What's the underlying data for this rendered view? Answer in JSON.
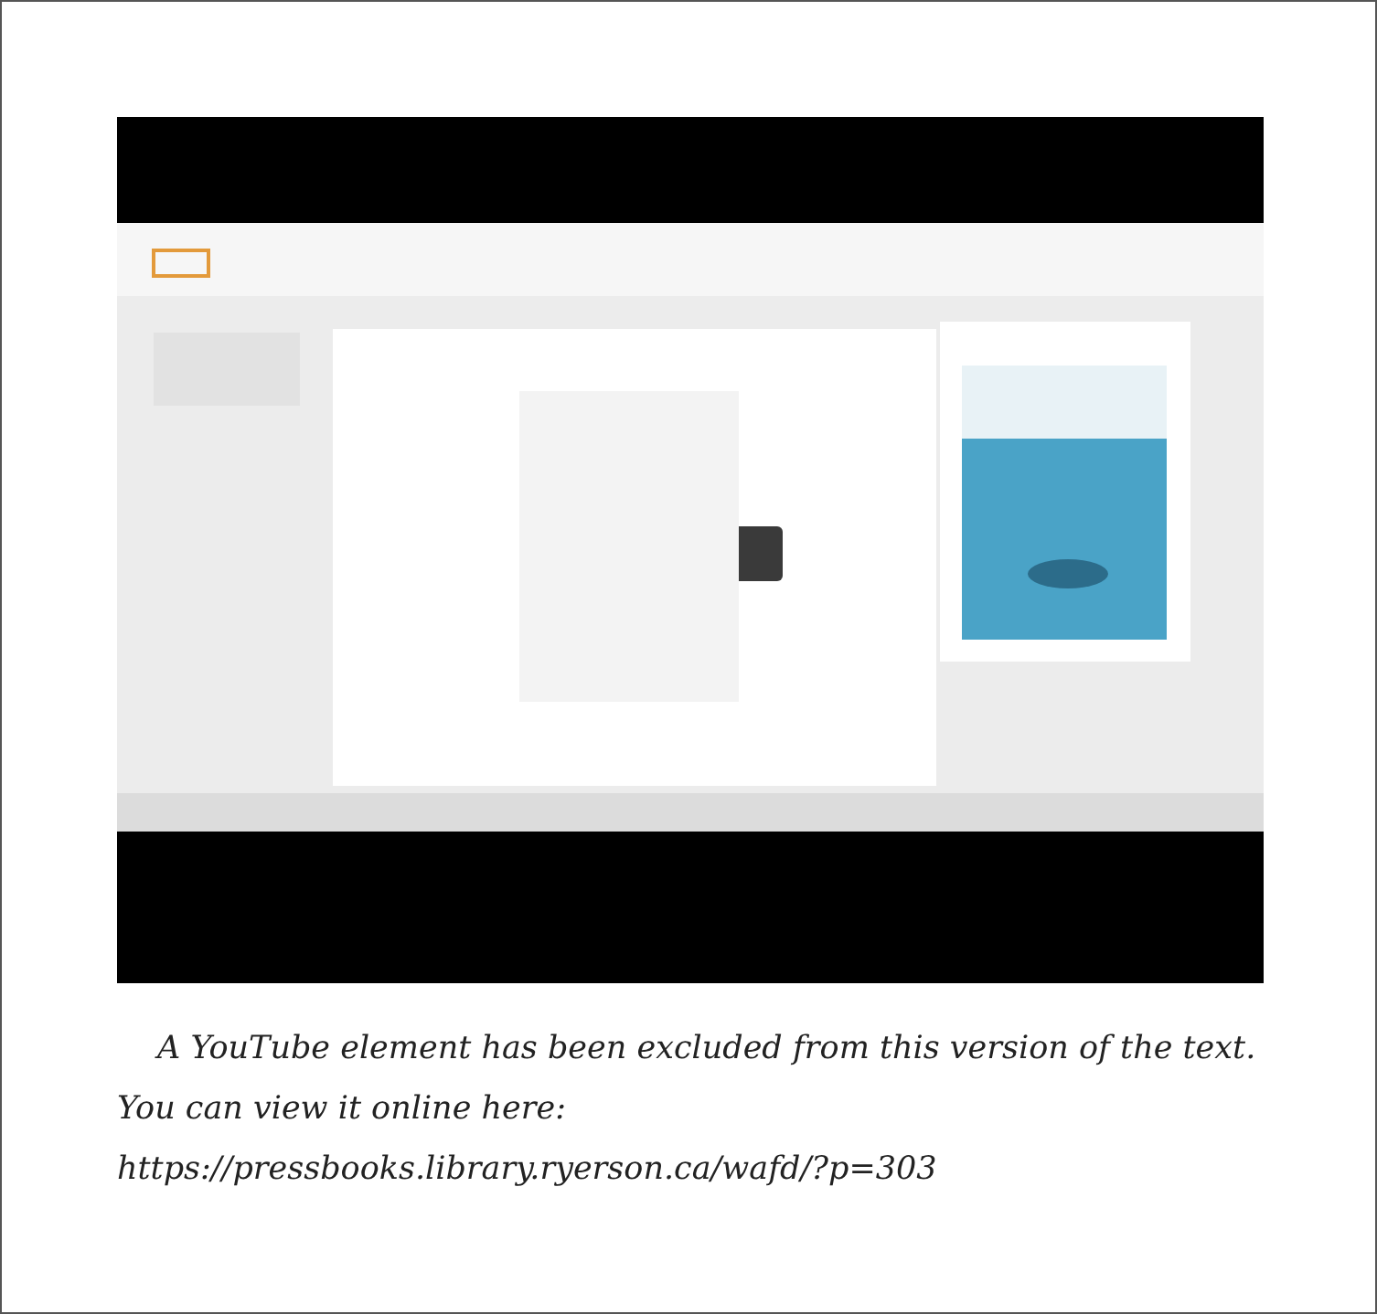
{
  "notice": {
    "text": "A YouTube element has been excluded from this version of the text. You can view it online here:",
    "url": "https://pressbooks.library.ryerson.ca/wafd/?p=303"
  }
}
